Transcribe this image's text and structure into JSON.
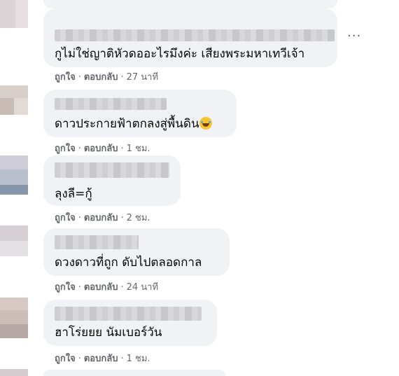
{
  "comments": [
    {
      "text": "กูไม่ใช่ญาติหัวดออะไรมึงค่ะ เสียงพระมหาเทวีเจ้า",
      "like": "ถูกใจ",
      "reply": "ตอบกลับ",
      "time": "27 นาที"
    },
    {
      "text": "ดาวประกายฟ้าตกลงสู่พื้นดิน",
      "emoji": "rolling-on-floor-laughing",
      "like": "ถูกใจ",
      "reply": "ตอบกลับ",
      "time": "1 ชม."
    },
    {
      "text": "ลุงลี=กู้",
      "like": "ถูกใจ",
      "reply": "ตอบกลับ",
      "time": "2 ชม."
    },
    {
      "text": "ดวงดาวที่ถูก ดับไปตลอดกาล",
      "like": "ถูกใจ",
      "reply": "ตอบกลับ",
      "time": "24 นาที"
    },
    {
      "text": "ฮาโร่ยยย นัมเบอร์วัน",
      "like": "ถูกใจ",
      "reply": "ตอบกลับ",
      "time": "1 ชม."
    }
  ],
  "more_icon": "more-horizontal-icon",
  "separator": "·"
}
